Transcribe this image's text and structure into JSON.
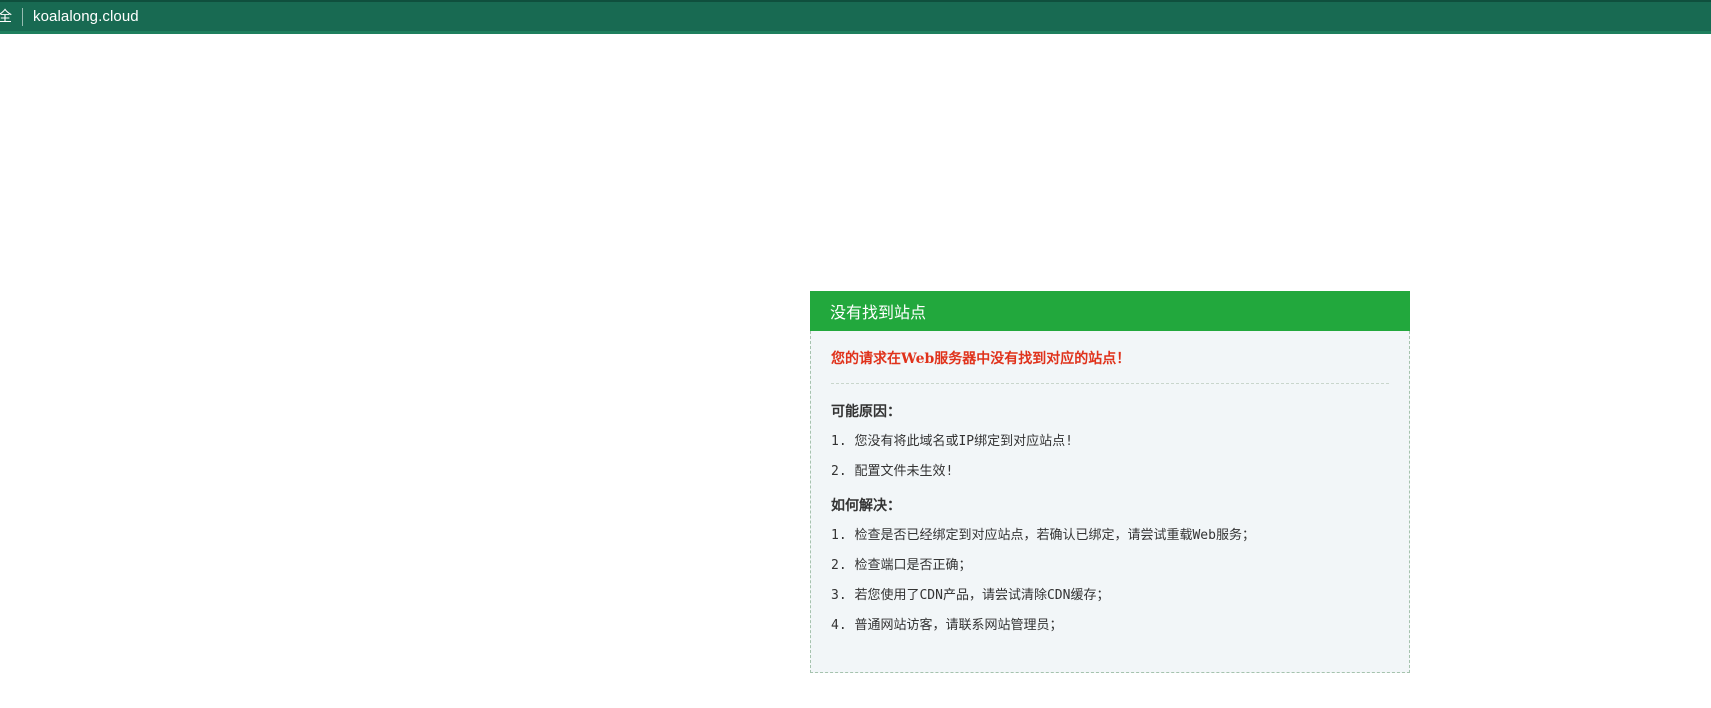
{
  "address_bar": {
    "security_glyph": "全",
    "url": "koalalong.cloud"
  },
  "panel": {
    "title": "没有找到站点",
    "error_message": "您的请求在Web服务器中没有找到对应的站点！",
    "reasons_title": "可能原因：",
    "reasons": [
      "1. 您没有将此域名或IP绑定到对应站点!",
      "2. 配置文件未生效!"
    ],
    "solutions_title": "如何解决：",
    "solutions": [
      "1. 检查是否已经绑定到对应站点，若确认已绑定，请尝试重载Web服务；",
      "2. 检查端口是否正确；",
      "3. 若您使用了CDN产品，请尝试清除CDN缓存；",
      "4. 普通网站访客，请联系网站管理员；"
    ]
  },
  "colors": {
    "address_bar": "#186a52",
    "panel_header": "#22a83d",
    "panel_body": "#f2f6f8",
    "error_text": "#e0321b"
  }
}
